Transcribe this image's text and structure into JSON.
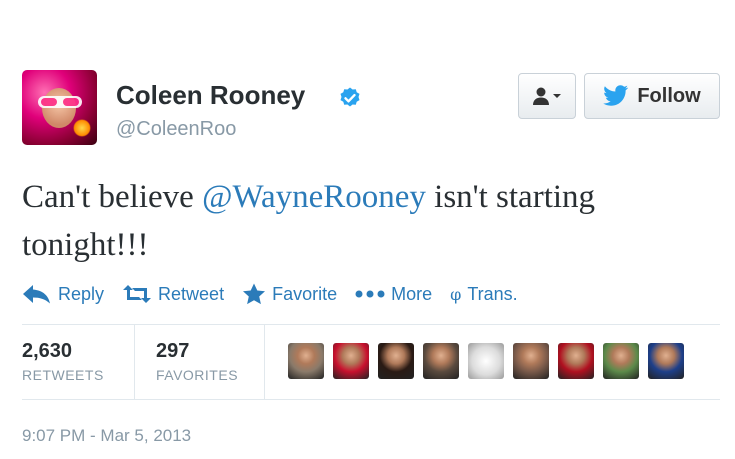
{
  "user": {
    "name": "Coleen Rooney",
    "handle": "@ColeenRoo",
    "verified": true
  },
  "buttons": {
    "follow_label": "Follow"
  },
  "tweet": {
    "text_before": "Can't believe ",
    "mention": "@WayneRooney",
    "text_after": " isn't starting tonight!!!"
  },
  "actions": {
    "reply": "Reply",
    "retweet": "Retweet",
    "favorite": "Favorite",
    "more": "More",
    "translate": "Trans."
  },
  "stats": {
    "retweets_count": "2,630",
    "retweets_label": "RETWEETS",
    "favorites_count": "297",
    "favorites_label": "FAVORITES"
  },
  "favoriters": [
    {
      "icon": "user-avatar",
      "color": "#8a7a6a"
    },
    {
      "icon": "user-avatar",
      "color": "#c8102e"
    },
    {
      "icon": "user-avatar",
      "color": "#2a1a14"
    },
    {
      "icon": "user-avatar",
      "color": "#5a4a3e"
    },
    {
      "icon": "crest-avatar",
      "color": "#dcdcdc"
    },
    {
      "icon": "user-avatar",
      "color": "#7a5a4a"
    },
    {
      "icon": "user-avatar",
      "color": "#b01020"
    },
    {
      "icon": "user-avatar",
      "color": "#5c8a4a"
    },
    {
      "icon": "user-avatar",
      "color": "#1d3f8a"
    }
  ],
  "timestamp": "9:07 PM - Mar 5, 2013",
  "colors": {
    "link": "#2b7bb9",
    "muted": "#8899a6",
    "text": "#292f33"
  }
}
